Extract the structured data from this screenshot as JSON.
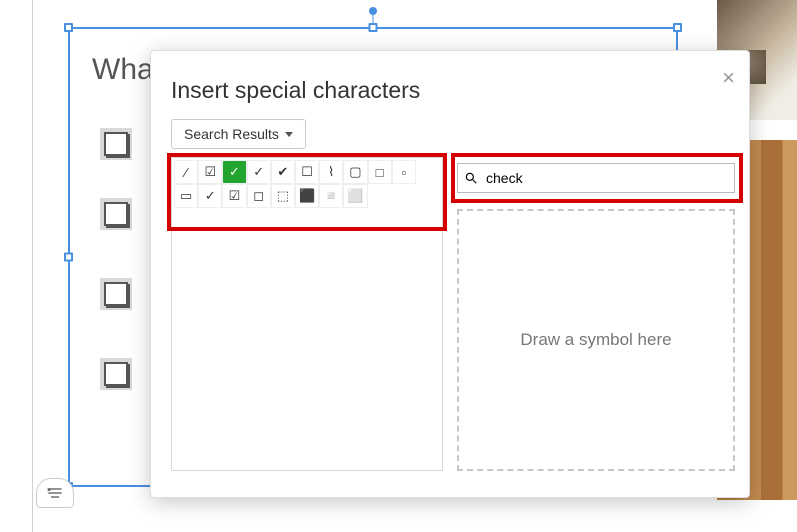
{
  "heading": "Wha",
  "dialog": {
    "title": "Insert special characters",
    "close": "×",
    "category": "Search Results",
    "search_value": "check",
    "search_placeholder": "",
    "draw_hint": "Draw a symbol here"
  },
  "results": [
    {
      "glyph": "⁄",
      "name": "fraction-slash"
    },
    {
      "glyph": "☑",
      "name": "ballot-box-with-check"
    },
    {
      "glyph": "✅",
      "name": "white-heavy-check-mark",
      "hot": true
    },
    {
      "glyph": "✓",
      "name": "check-mark"
    },
    {
      "glyph": "✔",
      "name": "heavy-check-mark"
    },
    {
      "glyph": "☐",
      "name": "ballot-box"
    },
    {
      "glyph": "⌇",
      "name": "wavy-line"
    },
    {
      "glyph": "▢",
      "name": "white-square-rounded"
    },
    {
      "glyph": "□",
      "name": "white-square"
    },
    {
      "glyph": "▫",
      "name": "white-small-square"
    },
    {
      "glyph": "▭",
      "name": "white-rectangle"
    },
    {
      "glyph": "✓",
      "name": "check-mark-2"
    },
    {
      "glyph": "☑",
      "name": "ballot-box-with-check-2"
    },
    {
      "glyph": "◻",
      "name": "white-medium-square"
    },
    {
      "glyph": "⬚",
      "name": "dotted-square"
    },
    {
      "glyph": "⬛",
      "name": "black-square-pattern"
    },
    {
      "glyph": "◽",
      "name": "white-medium-small-square"
    },
    {
      "glyph": "⬜",
      "name": "white-large-square"
    }
  ]
}
